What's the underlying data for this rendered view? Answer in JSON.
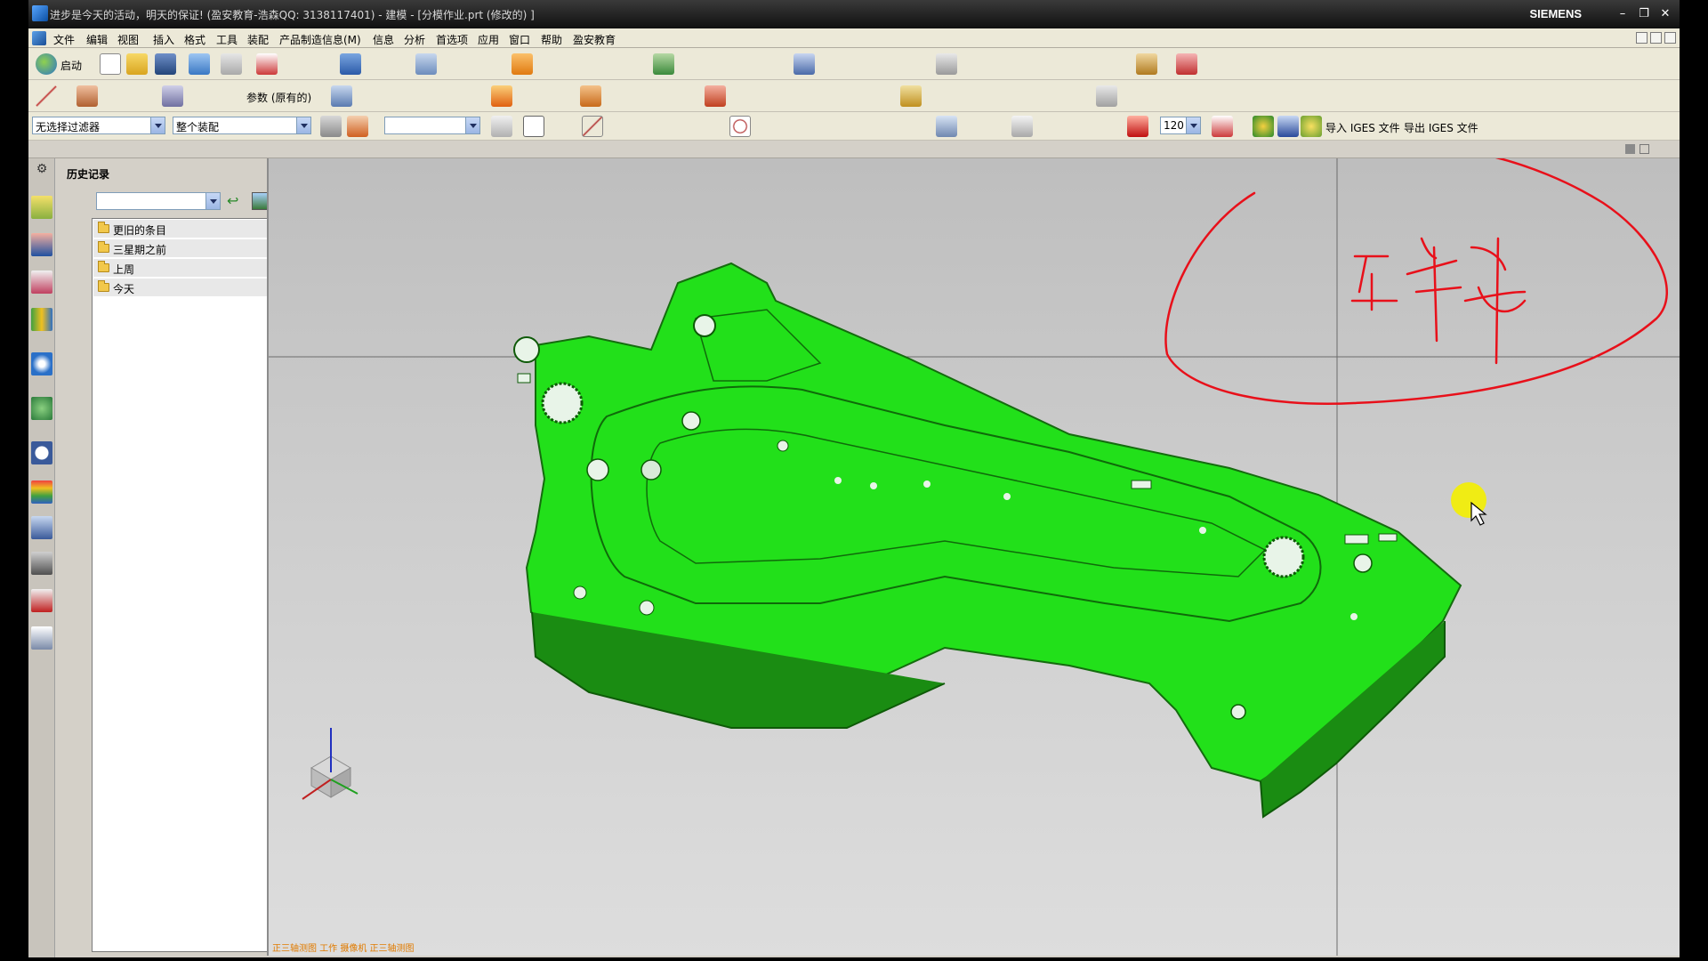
{
  "window": {
    "title": "进步是今天的活动，明天的保证!   (盈安教育-浩森QQ: 3138117401)  - 建模 - [分模作业.prt  (修改的) ]",
    "brand": "SIEMENS",
    "controls": [
      "–",
      "❐",
      "✕"
    ]
  },
  "menu": {
    "items": [
      "文件",
      "编辑",
      "视图",
      "插入",
      "格式",
      "工具",
      "装配",
      "产品制造信息(M)",
      "信息",
      "分析",
      "首选项",
      "应用",
      "窗口",
      "帮助",
      "盈安教育"
    ]
  },
  "toolbar": {
    "start_label": "启动",
    "params_label": "参数 (原有的)",
    "filter_value": "无选择过滤器",
    "scope_value": "整个装配",
    "layer_value": "",
    "scale_value": "120",
    "import_iges": "导入 IGES 文件",
    "export_iges": "导出 IGES 文件"
  },
  "history": {
    "title": "历史记录",
    "search_value": "",
    "items": [
      "更旧的条目",
      "三星期之前",
      "上周",
      "今天"
    ]
  },
  "viewport": {
    "model_color": "#22e01a",
    "annotation_color": "#e8101a",
    "cursor_highlight": "#f4ef00",
    "status_text": "正三轴测图 工作 摄像机 正三轴测图"
  }
}
